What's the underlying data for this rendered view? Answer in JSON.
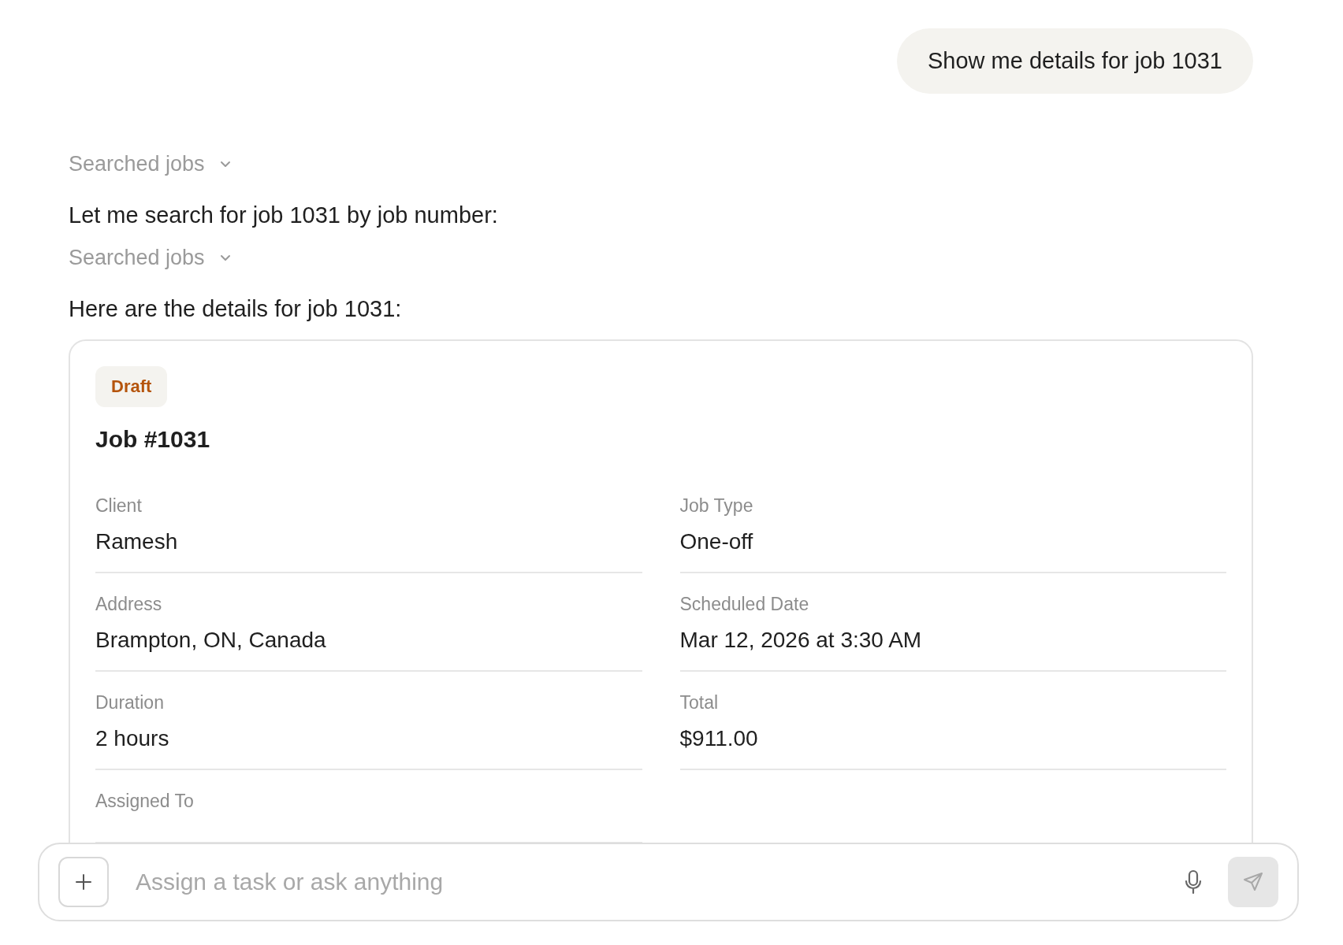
{
  "messages": [
    {
      "kind": "user",
      "text": "Show me details for job 1031"
    },
    {
      "kind": "tool",
      "text": "Searched jobs"
    },
    {
      "kind": "assistant",
      "text": "Let me search for job 1031 by job number:"
    },
    {
      "kind": "tool",
      "text": "Searched jobs"
    },
    {
      "kind": "assistant",
      "text": "Here are the details for job 1031:"
    },
    {
      "kind": "card",
      "badge": "Draft",
      "title": "Job #1031",
      "fields": [
        {
          "label": "Client",
          "value": "Ramesh"
        },
        {
          "label": "Job Type",
          "value": "One-off"
        },
        {
          "label": "Address",
          "value": "Brampton, ON, Canada"
        },
        {
          "label": "Scheduled Date",
          "value": "Mar 12, 2026 at 3:30 AM"
        },
        {
          "label": "Duration",
          "value": "2 hours"
        },
        {
          "label": "Total",
          "value": "$911.00"
        },
        {
          "label": "Assigned To"
        }
      ]
    }
  ],
  "composer": {
    "placeholder": "Assign a task or ask anything",
    "send_disabled": true
  }
}
